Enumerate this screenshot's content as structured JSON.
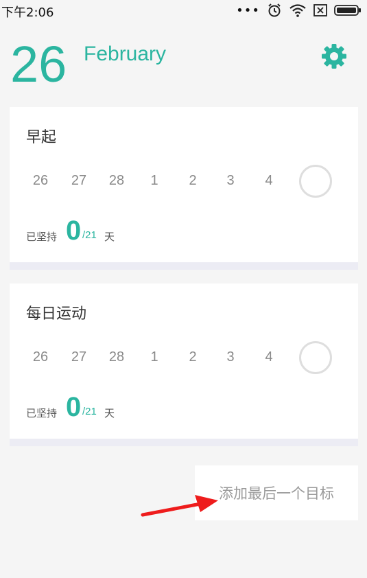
{
  "status_bar": {
    "time": "下午2:06",
    "more_glyph": "•••",
    "icons": [
      "alarm-clock-icon",
      "wifi-icon",
      "sim-icon",
      "battery-icon"
    ]
  },
  "header": {
    "day": "26",
    "month": "February"
  },
  "colors": {
    "accent": "#2bb5a0",
    "background": "#f5f5f5",
    "card": "#ffffff",
    "muted_text": "#8a8a8a"
  },
  "goals": [
    {
      "title": "早起",
      "days": [
        "26",
        "27",
        "28",
        "1",
        "2",
        "3",
        "4"
      ],
      "persist_label": "已坚持",
      "persist_count": "0",
      "persist_total": "/21",
      "persist_unit": "天"
    },
    {
      "title": "每日运动",
      "days": [
        "26",
        "27",
        "28",
        "1",
        "2",
        "3",
        "4"
      ],
      "persist_label": "已坚持",
      "persist_count": "0",
      "persist_total": "/21",
      "persist_unit": "天"
    }
  ],
  "add_goal": {
    "label": "添加最后一个目标"
  }
}
